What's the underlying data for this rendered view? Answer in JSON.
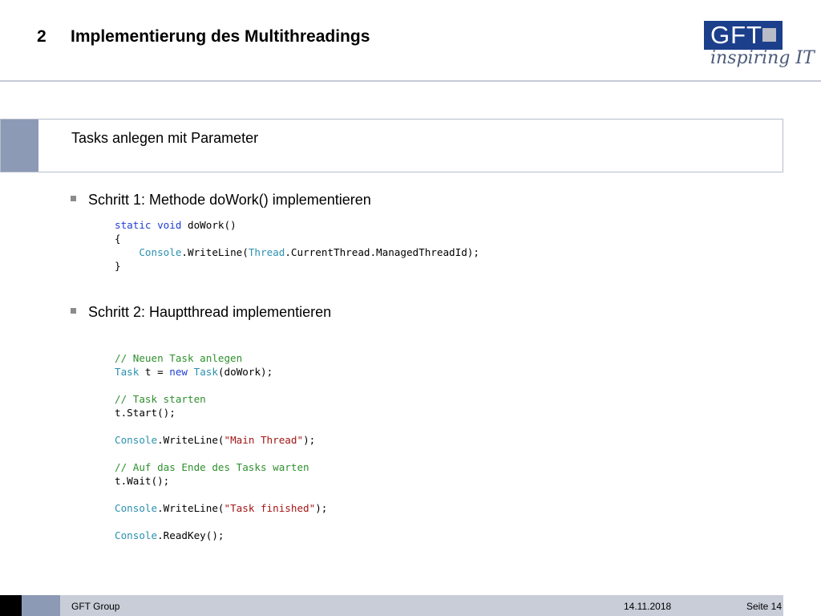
{
  "slide": {
    "chapter_number": "2",
    "title": "Implementierung des Multithreadings",
    "section_label": "Tasks anlegen mit Parameter"
  },
  "logo": {
    "brand": "GFT",
    "tagline": "inspiring IT"
  },
  "bullets": [
    "Schritt 1: Methode doWork() implementieren",
    "Schritt 2: Hauptthread implementieren"
  ],
  "code1": {
    "l1_kw1": "static",
    "l1_kw2": "void",
    "l1_rest": " doWork()",
    "l2": "{",
    "l3_type1": "Console",
    "l3_a": ".WriteLine(",
    "l3_type2": "Thread",
    "l3_b": ".CurrentThread.ManagedThreadId);",
    "l4": "}"
  },
  "code2": {
    "c1": "// Neuen Task anlegen",
    "l2_type1": "Task",
    "l2_a": " t = ",
    "l2_kw": "new",
    "l2_sp": " ",
    "l2_type2": "Task",
    "l2_b": "(doWork);",
    "c2": "// Task starten",
    "l4": "t.Start();",
    "l5_type": "Console",
    "l5_a": ".WriteLine(",
    "l5_str": "\"Main Thread\"",
    "l5_b": ");",
    "c3": "// Auf das Ende des Tasks warten",
    "l7": "t.Wait();",
    "l8_type": "Console",
    "l8_a": ".WriteLine(",
    "l8_str": "\"Task finished\"",
    "l8_b": ");",
    "l9_type": "Console",
    "l9_a": ".ReadKey();"
  },
  "footer": {
    "company": "GFT Group",
    "date": "14.11.2018",
    "page": "Seite 14"
  },
  "colors": {
    "logo_blue": "#1c3f8c",
    "accent_grey_blue": "#8d9ab6",
    "keyword": "#1f3fd6",
    "type": "#2b91af",
    "comment": "#2f8f2f",
    "string": "#a31515"
  }
}
